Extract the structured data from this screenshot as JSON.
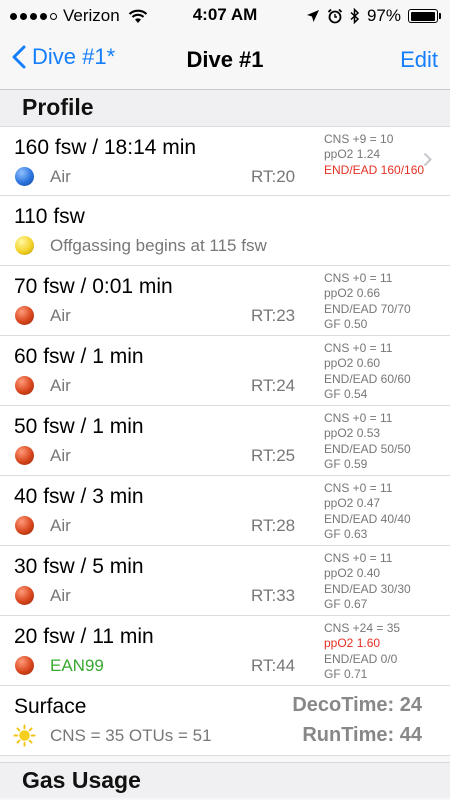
{
  "status": {
    "carrier": "Verizon",
    "time": "4:07 AM",
    "battery": "97%",
    "battery_level": 0.97
  },
  "nav": {
    "back_label": "Dive #1*",
    "title": "Dive #1",
    "edit_label": "Edit"
  },
  "sections": {
    "profile": "Profile",
    "gas_usage": "Gas Usage"
  },
  "rows": [
    {
      "title": "160 fsw / 18:14 min",
      "dot": "blue",
      "gas": "Air",
      "rt": "RT:20",
      "info": [
        "CNS +9 = 10",
        "ppO2 1.24",
        "END/EAD 160/160"
      ],
      "info_red": [
        false,
        false,
        true
      ],
      "chevron": true
    },
    {
      "title": "110 fsw",
      "dot": "yellow",
      "gas": "Offgassing begins at 115 fsw"
    },
    {
      "title": "70 fsw / 0:01 min",
      "dot": "red",
      "gas": "Air",
      "rt": "RT:23",
      "info": [
        "CNS +0 = 11",
        "ppO2 0.66",
        "END/EAD 70/70",
        "GF 0.50"
      ]
    },
    {
      "title": "60 fsw / 1 min",
      "dot": "red",
      "gas": "Air",
      "rt": "RT:24",
      "info": [
        "CNS +0 = 11",
        "ppO2 0.60",
        "END/EAD 60/60",
        "GF 0.54"
      ]
    },
    {
      "title": "50 fsw / 1 min",
      "dot": "red",
      "gas": "Air",
      "rt": "RT:25",
      "info": [
        "CNS +0 = 11",
        "ppO2 0.53",
        "END/EAD 50/50",
        "GF 0.59"
      ]
    },
    {
      "title": "40 fsw / 3 min",
      "dot": "red",
      "gas": "Air",
      "rt": "RT:28",
      "info": [
        "CNS +0 = 11",
        "ppO2 0.47",
        "END/EAD 40/40",
        "GF 0.63"
      ]
    },
    {
      "title": "30 fsw / 5 min",
      "dot": "red",
      "gas": "Air",
      "rt": "RT:33",
      "info": [
        "CNS +0 = 11",
        "ppO2 0.40",
        "END/EAD 30/30",
        "GF 0.67"
      ]
    },
    {
      "title": "20 fsw / 11 min",
      "dot": "red",
      "gas": "EAN99",
      "gas_green": true,
      "rt": "RT:44",
      "info": [
        "CNS +24 = 35",
        "ppO2 1.60",
        "END/EAD 0/0",
        "GF 0.71"
      ],
      "info_red": [
        false,
        true,
        false,
        false
      ]
    }
  ],
  "surface": {
    "title": "Surface",
    "summary": "CNS = 35 OTUs = 51",
    "deco_time": "DecoTime: 24",
    "run_time": "RunTime: 44"
  },
  "colors": {
    "accent": "#147efb",
    "warning": "#e53024",
    "gas_green": "#3aa932"
  }
}
